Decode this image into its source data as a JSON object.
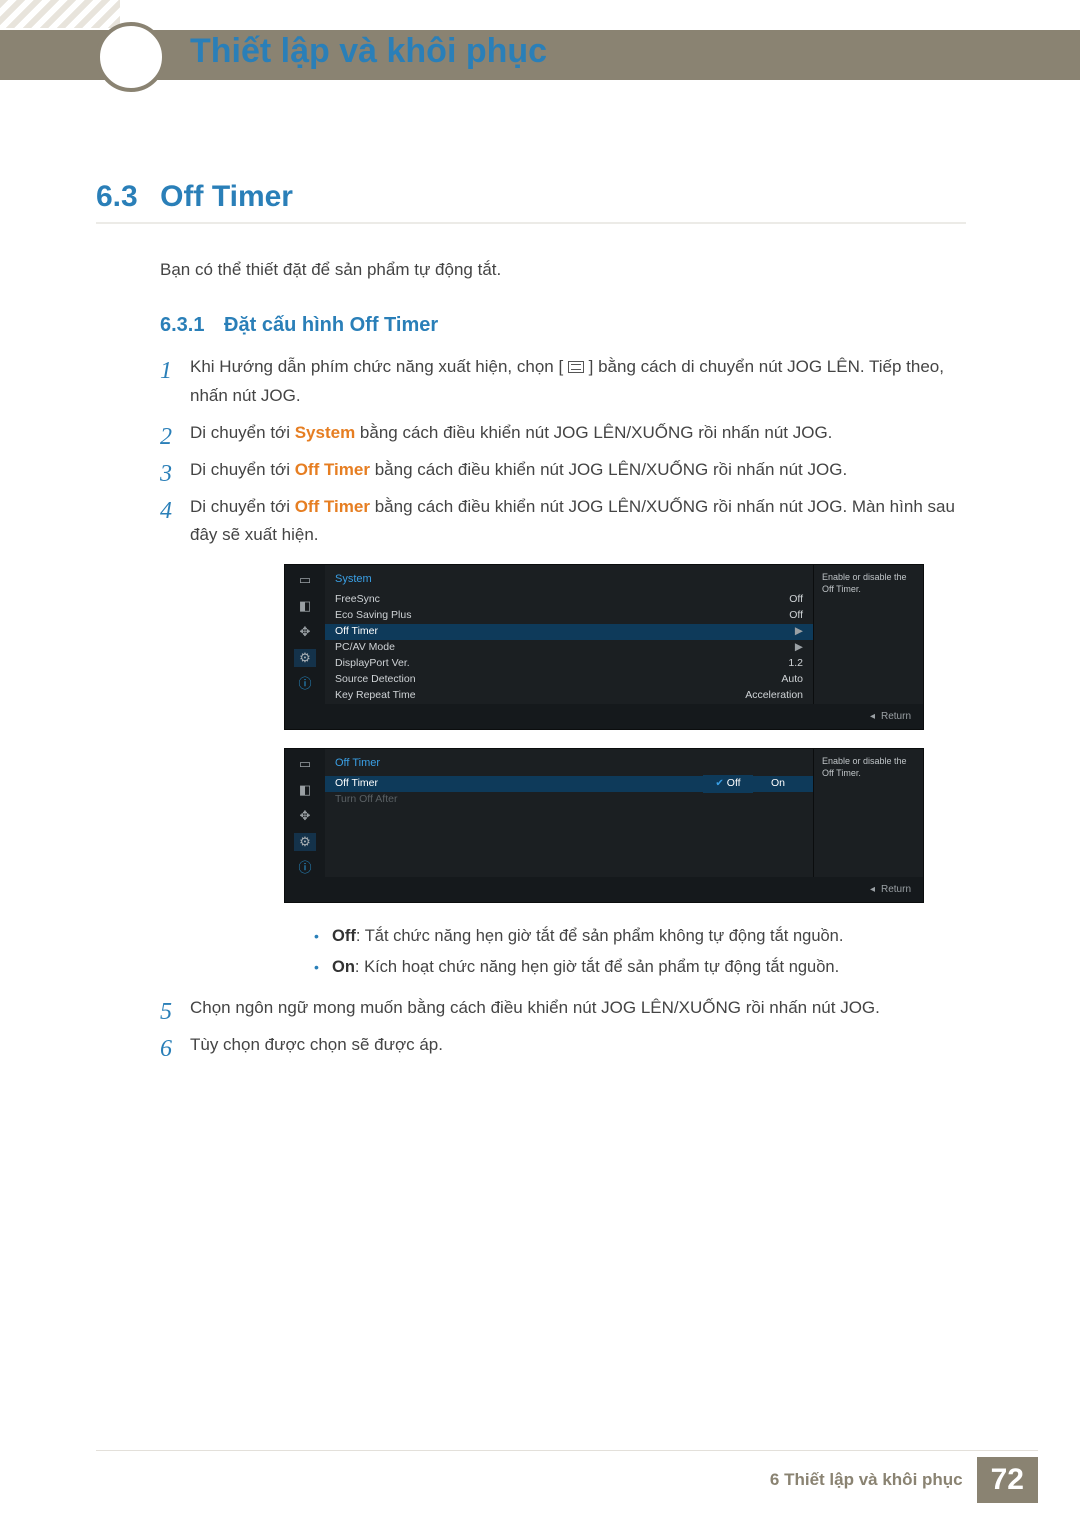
{
  "header": {
    "chapter_title": "Thiết lập và khôi phục"
  },
  "section": {
    "number": "6.3",
    "title": "Off Timer"
  },
  "intro": "Bạn có thể thiết đặt để sản phẩm tự động tắt.",
  "subsection": {
    "number": "6.3.1",
    "title": "Đặt cấu hình Off Timer"
  },
  "steps": {
    "s1a": "Khi Hướng dẫn phím chức năng xuất hiện, chọn [",
    "s1b": "] bằng cách di chuyển nút JOG LÊN. Tiếp theo, nhấn nút JOG.",
    "s2a": "Di chuyển tới ",
    "s2b": " bằng cách điều khiển nút JOG LÊN/XUỐNG rồi nhấn nút JOG.",
    "s2_kw": "System",
    "s3a": "Di chuyển tới ",
    "s3b": " bằng cách điều khiển nút JOG LÊN/XUỐNG rồi nhấn nút JOG.",
    "s3_kw": "Off Timer",
    "s4a": "Di chuyển tới ",
    "s4b": " bằng cách điều khiển nút JOG LÊN/XUỐNG rồi nhấn nút JOG. Màn hình sau đây sẽ xuất hiện.",
    "s4_kw": "Off Timer",
    "s5": "Chọn ngôn ngữ mong muốn bằng cách điều khiển nút JOG LÊN/XUỐNG rồi nhấn nút JOG.",
    "s6": "Tùy chọn được chọn sẽ được áp."
  },
  "osd1": {
    "title": "System",
    "help": "Enable or disable the Off Timer.",
    "return": "Return",
    "rows": [
      {
        "label": "FreeSync",
        "value": "Off"
      },
      {
        "label": "Eco Saving Plus",
        "value": "Off"
      },
      {
        "label": "Off Timer",
        "value": "▶",
        "selected": true
      },
      {
        "label": "PC/AV Mode",
        "value": "▶"
      },
      {
        "label": "DisplayPort Ver.",
        "value": "1.2"
      },
      {
        "label": "Source Detection",
        "value": "Auto"
      },
      {
        "label": "Key Repeat Time",
        "value": "Acceleration"
      }
    ]
  },
  "osd2": {
    "title": "Off Timer",
    "help": "Enable or disable the Off Timer.",
    "return": "Return",
    "rows": [
      {
        "label": "Off Timer",
        "off": "Off",
        "on": "On",
        "selected": true,
        "picked": "off"
      },
      {
        "label": "Turn Off After",
        "dim": true
      }
    ]
  },
  "bullets": {
    "off_label": "Off",
    "off_text": ": Tắt chức năng hẹn giờ tắt để sản phẩm không tự động tắt nguồn.",
    "on_label": "On",
    "on_text": ": Kích hoạt chức năng hẹn giờ tắt để sản phẩm tự động tắt nguồn."
  },
  "footer": {
    "text": "6 Thiết lập và khôi phục",
    "page": "72"
  }
}
